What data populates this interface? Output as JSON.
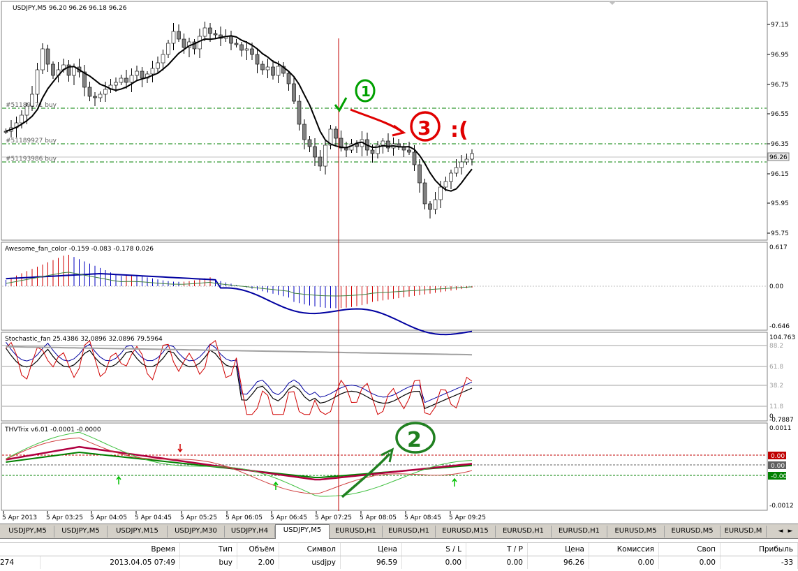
{
  "main_chart": {
    "title": "USDJPY,M5  96.20 96.26 96.18 96.26",
    "price_ticks": [
      "97.15",
      "96.95",
      "96.75",
      "96.55",
      "96.35",
      "96.15",
      "95.95",
      "95.75"
    ],
    "current_price": "96.26",
    "order_labels": [
      "#51189271 buy",
      "#51189927 buy",
      "#51193986 buy"
    ],
    "annotations": {
      "one": "1",
      "two": "2",
      "three": "3",
      "sad": ":("
    },
    "colors": {
      "bull": "#ffffff",
      "bear": "#808080",
      "ma": "#000000",
      "order_line": "#008000",
      "vline": "#c00000",
      "annot_green": "#00a000",
      "annot_red": "#e00000"
    },
    "time_labels": [
      "5 Apr 2013",
      "5 Apr 03:25",
      "5 Apr 04:05",
      "5 Apr 04:45",
      "5 Apr 05:25",
      "5 Apr 06:05",
      "5 Apr 06:45",
      "5 Apr 07:25",
      "5 Apr 08:05",
      "5 Apr 08:45",
      "5 Apr 09:25"
    ]
  },
  "ao_panel": {
    "title": "Awesome_fan_color -0.159 -0.083 -0.178 0.026",
    "ticks": [
      "0.617",
      "0.00",
      "-0.646"
    ]
  },
  "stoch_panel": {
    "title": "Stochastic_fan 25.4386 32.0896 32.0896 79.5964",
    "ticks": [
      "104.763",
      "88.2",
      "61.8",
      "38.2",
      "11.8",
      "0",
      "-0.7887"
    ]
  },
  "trix_panel": {
    "title": "THVTrix v6.01 -0.0001 -0.0000",
    "ticks": [
      "0.0011",
      "-0.0012"
    ],
    "level_labels": [
      {
        "text": "0.00",
        "color": "#c00000"
      },
      {
        "text": "0.00",
        "color": "#606060"
      },
      {
        "text": "-0.00",
        "color": "#008000"
      }
    ]
  },
  "tabs": [
    "USDJPY,M5",
    "USDJPY,M5",
    "USDJPY,M15",
    "USDJPY,M30",
    "USDJPY,H4",
    "USDJPY,M5",
    "EURUSD,H1",
    "EURUSD,H1",
    "EURUSD,M15",
    "EURUSD,H1",
    "EURUSD,H1",
    "EURUSD,M5",
    "EURUSD,M5",
    "EURUSD,M"
  ],
  "active_tab_index": 5,
  "terminal": {
    "headers": [
      "Время",
      "Тип",
      "Объём",
      "Символ",
      "Цена",
      "S / L",
      "T / P",
      "Цена",
      "Комиссия",
      "Своп",
      "Прибыль"
    ],
    "row": [
      "274",
      "2013.04.05 07:49",
      "buy",
      "2.00",
      "usdjpy",
      "96.59",
      "0.00",
      "0.00",
      "96.26",
      "0.00",
      "0.00",
      "-33"
    ]
  }
}
